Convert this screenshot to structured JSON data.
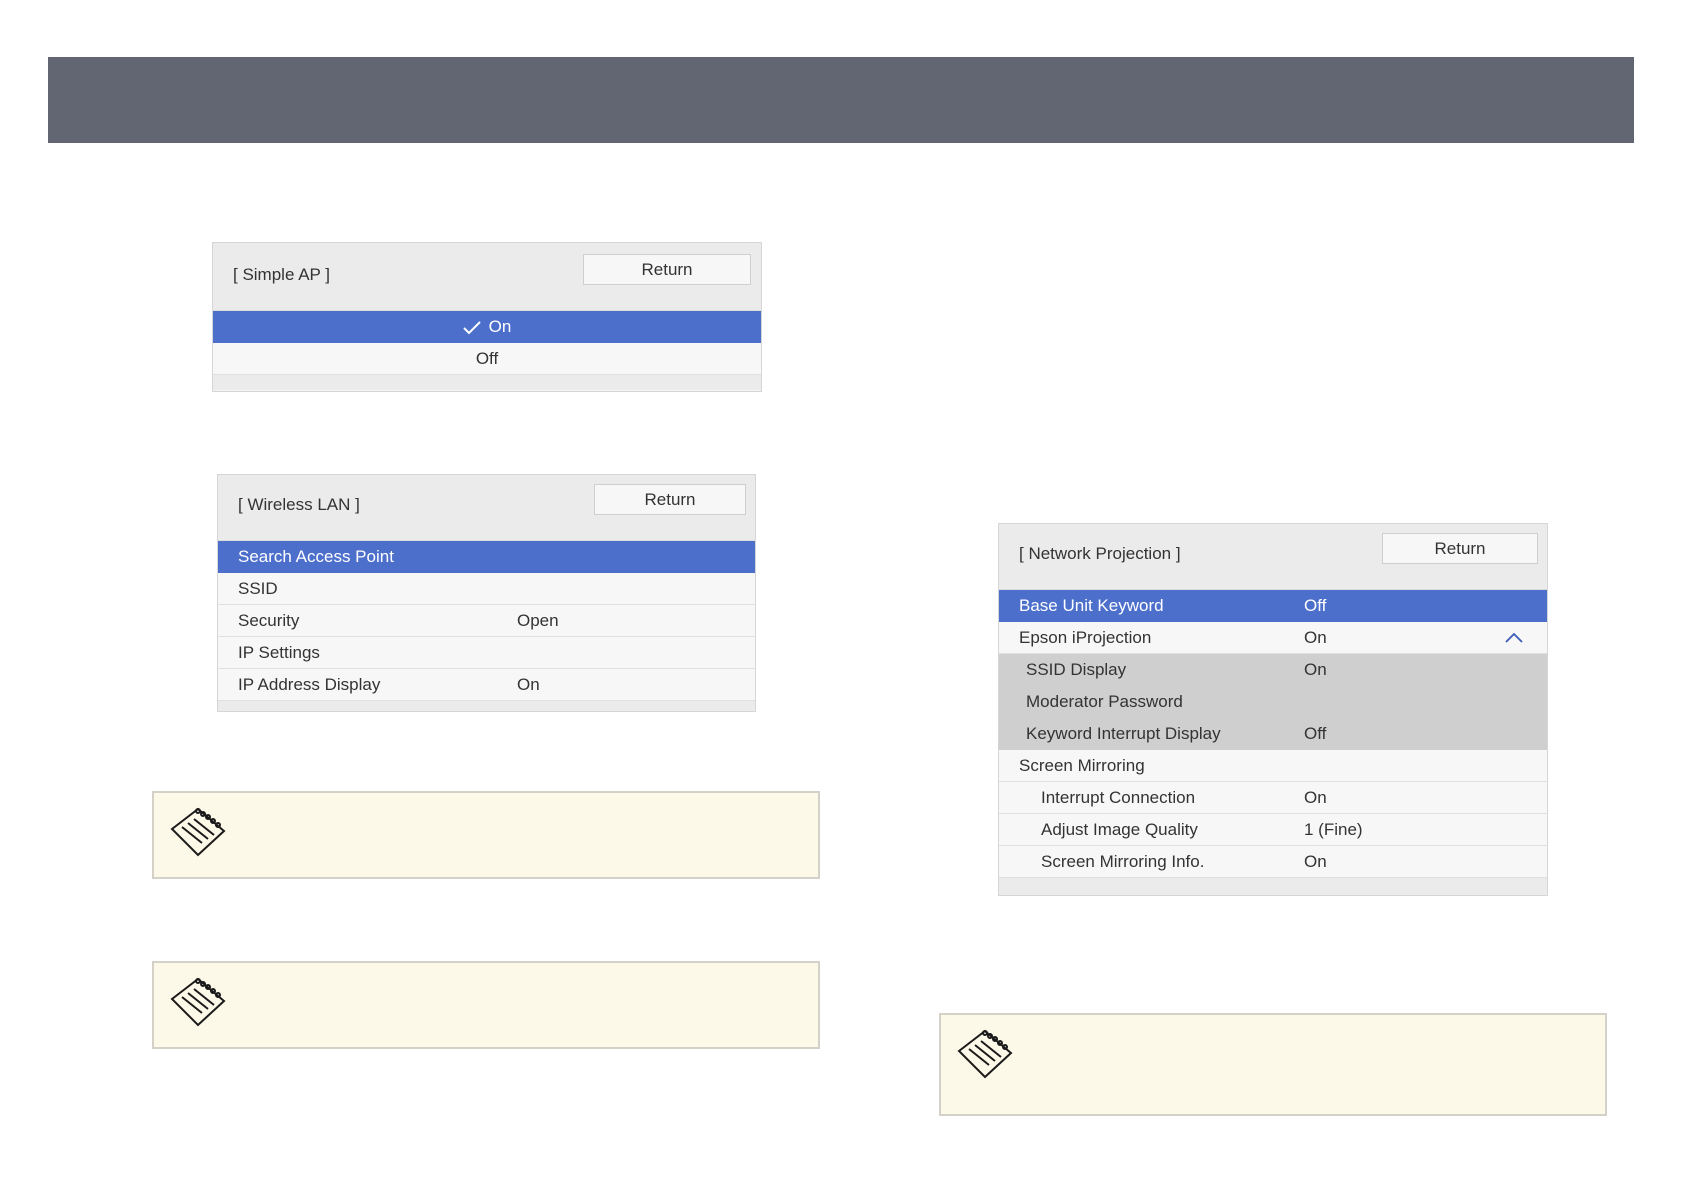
{
  "simple_ap": {
    "title": "[ Simple AP ]",
    "return_label": "Return",
    "options": [
      {
        "label": "On",
        "selected": true
      },
      {
        "label": "Off",
        "selected": false
      }
    ]
  },
  "wireless_lan": {
    "title": "[ Wireless LAN ]",
    "return_label": "Return",
    "rows": [
      {
        "label": "Search Access Point",
        "value": ""
      },
      {
        "label": "SSID",
        "value": ""
      },
      {
        "label": "Security",
        "value": "Open"
      },
      {
        "label": "IP Settings",
        "value": ""
      },
      {
        "label": "IP Address Display",
        "value": "On"
      }
    ]
  },
  "network_projection": {
    "title": "[ Network Projection ]",
    "return_label": "Return",
    "rows": [
      {
        "label": "Base Unit Keyword",
        "value": "Off"
      },
      {
        "label": "Epson iProjection",
        "value": "On"
      },
      {
        "label": "SSID Display",
        "value": "On"
      },
      {
        "label": "Moderator Password",
        "value": ""
      },
      {
        "label": "Keyword Interrupt Display",
        "value": "Off"
      },
      {
        "label": "Screen Mirroring",
        "value": ""
      },
      {
        "label": "Interrupt Connection",
        "value": "On"
      },
      {
        "label": "Adjust Image Quality",
        "value": "1 (Fine)"
      },
      {
        "label": "Screen Mirroring Info.",
        "value": "On"
      }
    ]
  },
  "colors": {
    "header": "#626673",
    "selected_row": "#4d6fcc",
    "note_background": "#fdf9e8"
  },
  "icons": [
    "check-icon",
    "note-pad-icon",
    "chevron-up-icon"
  ]
}
